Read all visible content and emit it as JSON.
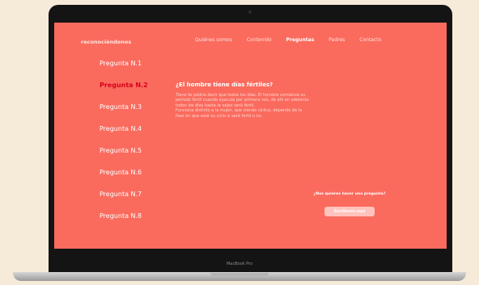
{
  "brand": "reconociéndonos",
  "nav": {
    "items": [
      "Quiénes somos",
      "Contenido",
      "Preguntas",
      "Padres",
      "Contacto"
    ],
    "active": "Preguntas"
  },
  "sidebar": {
    "items": [
      "Pregunta N.1",
      "Pregunta N.2",
      "Pregunta N.3",
      "Pregunta N.4",
      "Pregunta N.5",
      "Pregunta N.6",
      "Pregunta N.7",
      "Pregunta N.8"
    ],
    "active_index": 1
  },
  "question": {
    "title": "¿El hombre tiene días fértiles?",
    "answer_lines": [
      "Tiene te podría decir que todos los días. El hombre comienza su",
      "periodo fértil cuando eyacula por primera vez, de ahí en adelante",
      "todos los días hasta la vejez será fértil.",
      "Funciona distinto a la mujer, que siendo cíclica, depende de la",
      "fase en que esté su ciclo si será fértil o no."
    ]
  },
  "contact": {
    "prompt": "¿Nos quieres hacer una pregunta?",
    "button_label": "Escríbenos aquí"
  },
  "device": {
    "model_label": "MacBook Pro"
  },
  "colors": {
    "background": "#f6ead8",
    "screen": "#fa6b5e",
    "active_question": "#d9001b",
    "button": "#ffc2bd"
  }
}
